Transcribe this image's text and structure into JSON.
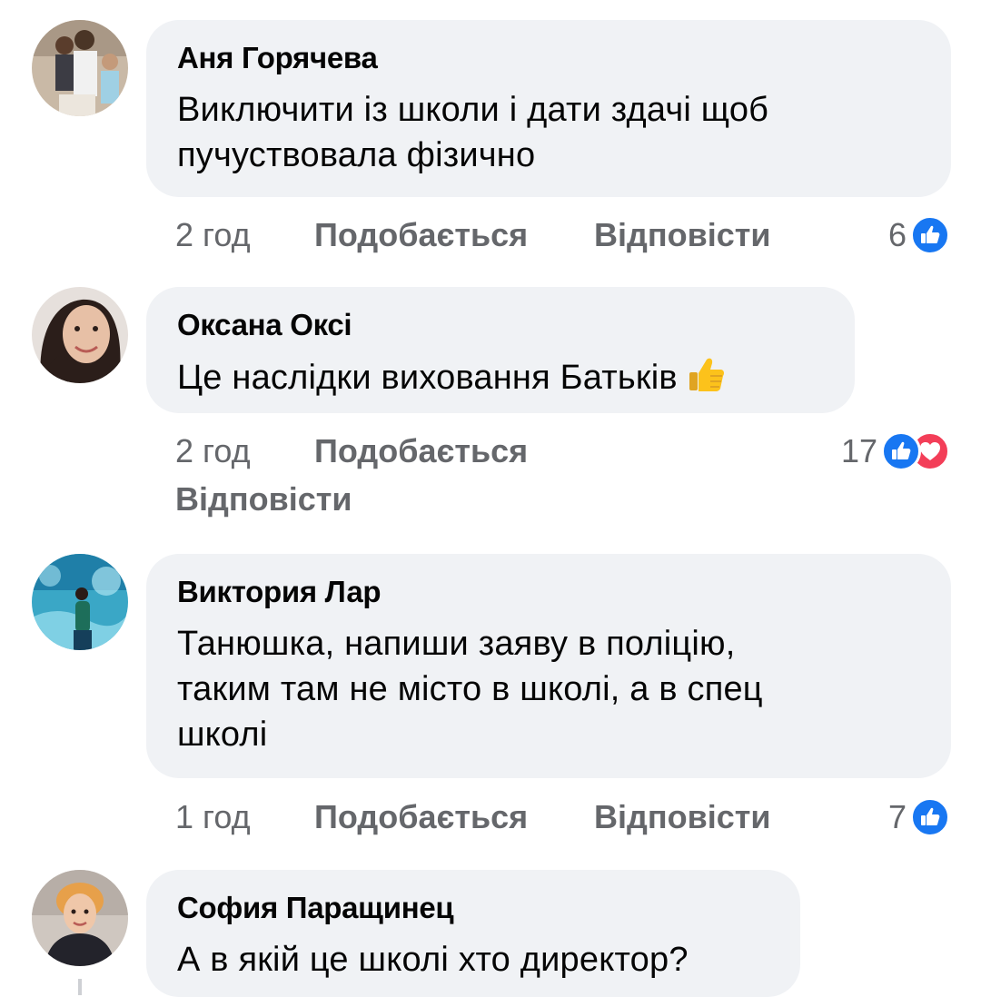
{
  "comments": [
    {
      "author": "Аня Горячева",
      "lines": [
        "Виключити із школи і дати здачі щоб",
        "пучуствовала фізично"
      ],
      "time": "2 год",
      "like_label": "Подобається",
      "reply_label": "Відповісти",
      "reaction_count": "6",
      "reactions": [
        "like-icon"
      ]
    },
    {
      "author": "Оксана Оксі",
      "lines": [
        "Це наслідки виховання Батьків"
      ],
      "emoji": "thumbs-up-emoji",
      "time": "2 год",
      "like_label": "Подобається",
      "reply_label": "Відповісти",
      "reaction_count": "17",
      "reactions": [
        "like-icon",
        "love-icon"
      ]
    },
    {
      "author": "Виктория Лар",
      "lines": [
        "Танюшка, напиши заяву в поліцію,",
        "таким там не місто в школі, а в спец",
        "школі"
      ],
      "time": "1 год",
      "like_label": "Подобається",
      "reply_label": "Відповісти",
      "reaction_count": "7",
      "reactions": [
        "like-icon"
      ]
    },
    {
      "author": "София Паращинец",
      "lines": [
        "А в якій це школі хто директор?"
      ]
    }
  ],
  "colors": {
    "bubble": "#f0f2f5",
    "secondary_text": "#65676b",
    "like_blue": "#1877f2",
    "love_red": "#f33e58"
  }
}
